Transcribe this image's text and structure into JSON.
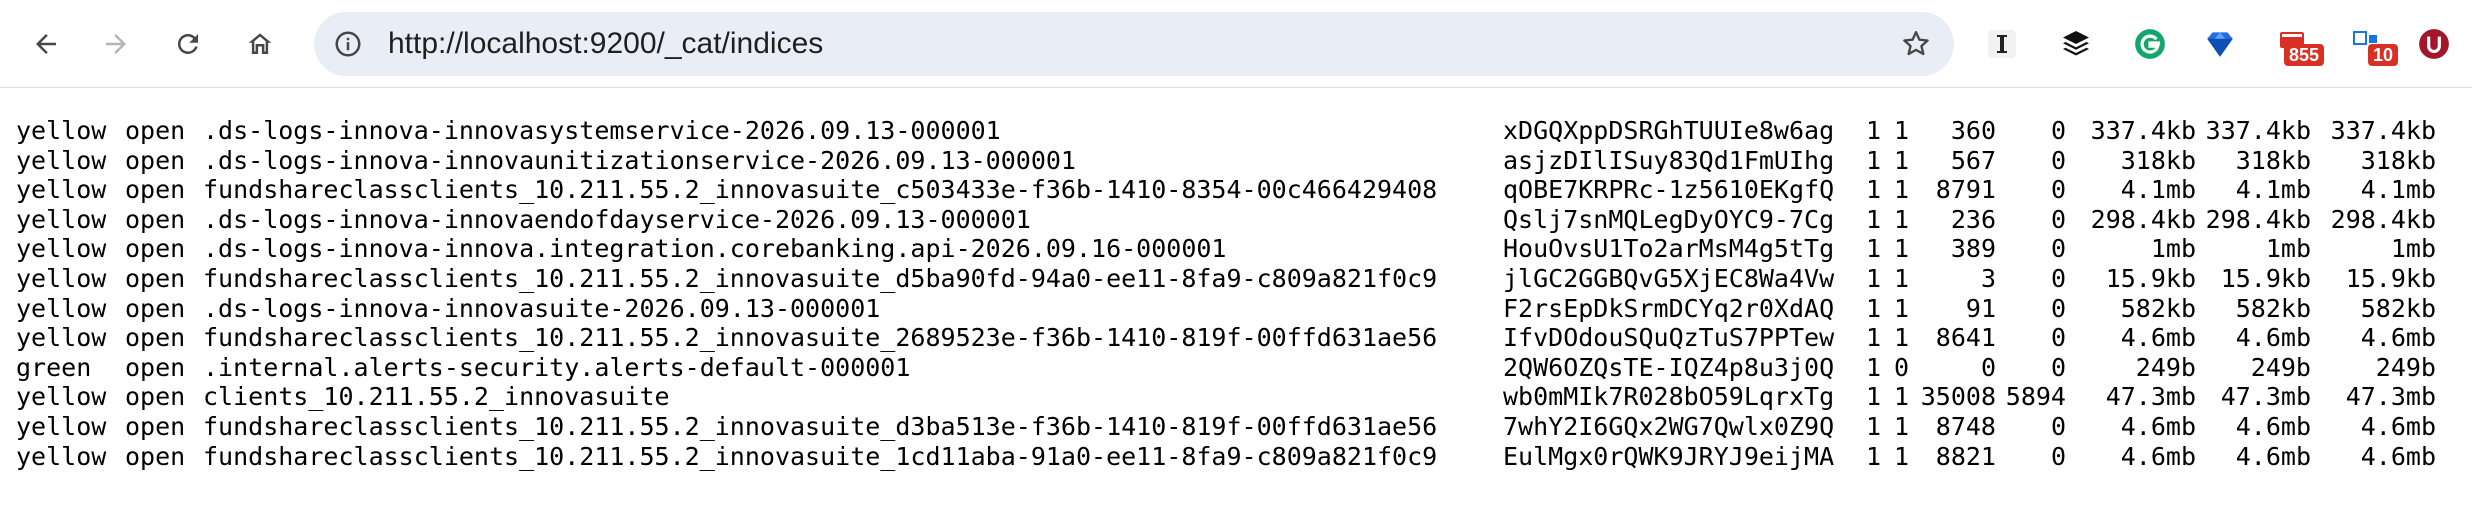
{
  "browser": {
    "url": "http://localhost:9200/_cat/indices",
    "extensions": [
      {
        "name": "instapaper",
        "badge": ""
      },
      {
        "name": "buffer",
        "badge": ""
      },
      {
        "name": "grammarly",
        "badge": ""
      },
      {
        "name": "diamond",
        "badge": ""
      },
      {
        "name": "mail",
        "badge": "855"
      },
      {
        "name": "calendar",
        "badge": "10"
      },
      {
        "name": "u-logo",
        "badge": ""
      }
    ]
  },
  "indices": [
    {
      "health": "yellow",
      "status": "open",
      "index": ".ds-logs-innova-innovasystemservice-2026.09.13-000001",
      "uuid": "xDGQXppDSRGhTUUIe8w6ag",
      "pri": "1",
      "rep": "1",
      "docs_count": "360",
      "docs_deleted": "0",
      "store_size": "337.4kb",
      "pri_store_size": "337.4kb",
      "dataset_size": "337.4kb"
    },
    {
      "health": "yellow",
      "status": "open",
      "index": ".ds-logs-innova-innovaunitizationservice-2026.09.13-000001",
      "uuid": "asjzDIlISuy83Qd1FmUIhg",
      "pri": "1",
      "rep": "1",
      "docs_count": "567",
      "docs_deleted": "0",
      "store_size": "318kb",
      "pri_store_size": "318kb",
      "dataset_size": "318kb"
    },
    {
      "health": "yellow",
      "status": "open",
      "index": "fundshareclassclients_10.211.55.2_innovasuite_c503433e-f36b-1410-8354-00c466429408",
      "uuid": "qOBE7KRPRc-1z5610EKgfQ",
      "pri": "1",
      "rep": "1",
      "docs_count": "8791",
      "docs_deleted": "0",
      "store_size": "4.1mb",
      "pri_store_size": "4.1mb",
      "dataset_size": "4.1mb"
    },
    {
      "health": "yellow",
      "status": "open",
      "index": ".ds-logs-innova-innovaendofdayservice-2026.09.13-000001",
      "uuid": "Qslj7snMQLegDyOYC9-7Cg",
      "pri": "1",
      "rep": "1",
      "docs_count": "236",
      "docs_deleted": "0",
      "store_size": "298.4kb",
      "pri_store_size": "298.4kb",
      "dataset_size": "298.4kb"
    },
    {
      "health": "yellow",
      "status": "open",
      "index": ".ds-logs-innova-innova.integration.corebanking.api-2026.09.16-000001",
      "uuid": "HouOvsU1To2arMsM4g5tTg",
      "pri": "1",
      "rep": "1",
      "docs_count": "389",
      "docs_deleted": "0",
      "store_size": "1mb",
      "pri_store_size": "1mb",
      "dataset_size": "1mb"
    },
    {
      "health": "yellow",
      "status": "open",
      "index": "fundshareclassclients_10.211.55.2_innovasuite_d5ba90fd-94a0-ee11-8fa9-c809a821f0c9",
      "uuid": "jlGC2GGBQvG5XjEC8Wa4Vw",
      "pri": "1",
      "rep": "1",
      "docs_count": "3",
      "docs_deleted": "0",
      "store_size": "15.9kb",
      "pri_store_size": "15.9kb",
      "dataset_size": "15.9kb"
    },
    {
      "health": "yellow",
      "status": "open",
      "index": ".ds-logs-innova-innovasuite-2026.09.13-000001",
      "uuid": "F2rsEpDkSrmDCYq2r0XdAQ",
      "pri": "1",
      "rep": "1",
      "docs_count": "91",
      "docs_deleted": "0",
      "store_size": "582kb",
      "pri_store_size": "582kb",
      "dataset_size": "582kb"
    },
    {
      "health": "yellow",
      "status": "open",
      "index": "fundshareclassclients_10.211.55.2_innovasuite_2689523e-f36b-1410-819f-00ffd631ae56",
      "uuid": "IfvDOdouSQuQzTuS7PPTew",
      "pri": "1",
      "rep": "1",
      "docs_count": "8641",
      "docs_deleted": "0",
      "store_size": "4.6mb",
      "pri_store_size": "4.6mb",
      "dataset_size": "4.6mb"
    },
    {
      "health": "green",
      "status": "open",
      "index": ".internal.alerts-security.alerts-default-000001",
      "uuid": "2QW6OZQsTE-IQZ4p8u3j0Q",
      "pri": "1",
      "rep": "0",
      "docs_count": "0",
      "docs_deleted": "0",
      "store_size": "249b",
      "pri_store_size": "249b",
      "dataset_size": "249b"
    },
    {
      "health": "yellow",
      "status": "open",
      "index": "clients_10.211.55.2_innovasuite",
      "uuid": "wb0mMIk7R028bO59LqrxTg",
      "pri": "1",
      "rep": "1",
      "docs_count": "35008",
      "docs_deleted": "5894",
      "store_size": "47.3mb",
      "pri_store_size": "47.3mb",
      "dataset_size": "47.3mb"
    },
    {
      "health": "yellow",
      "status": "open",
      "index": "fundshareclassclients_10.211.55.2_innovasuite_d3ba513e-f36b-1410-819f-00ffd631ae56",
      "uuid": "7whY2I6GQx2WG7Qwlx0Z9Q",
      "pri": "1",
      "rep": "1",
      "docs_count": "8748",
      "docs_deleted": "0",
      "store_size": "4.6mb",
      "pri_store_size": "4.6mb",
      "dataset_size": "4.6mb"
    },
    {
      "health": "yellow",
      "status": "open",
      "index": "fundshareclassclients_10.211.55.2_innovasuite_1cd11aba-91a0-ee11-8fa9-c809a821f0c9",
      "uuid": "EulMgx0rQWK9JRYJ9eijMA",
      "pri": "1",
      "rep": "1",
      "docs_count": "8821",
      "docs_deleted": "0",
      "store_size": "4.6mb",
      "pri_store_size": "4.6mb",
      "dataset_size": "4.6mb"
    }
  ]
}
